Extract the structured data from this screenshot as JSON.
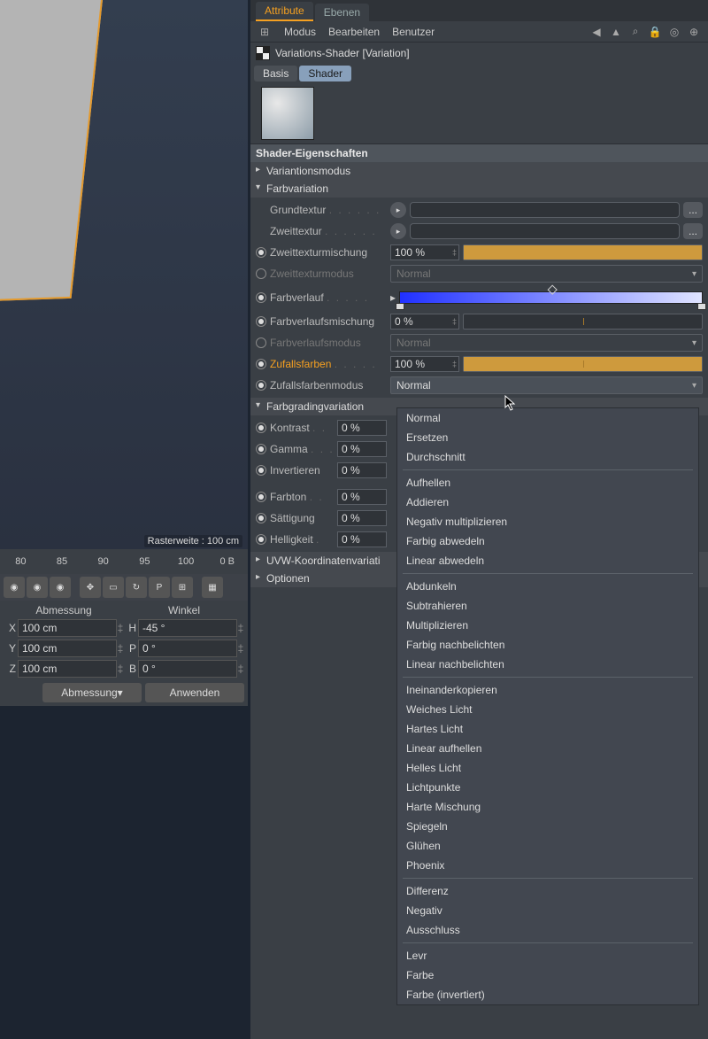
{
  "viewport": {
    "grid_label": "Rasterweite : 100 cm"
  },
  "timeline": {
    "marks": [
      "80",
      "85",
      "90",
      "95",
      "100"
    ],
    "frames": "0 B"
  },
  "coords": {
    "head_dim": "Abmessung",
    "head_ang": "Winkel",
    "x": "X",
    "y": "Y",
    "z": "Z",
    "h": "H",
    "p": "P",
    "b": "B",
    "vx": "100 cm",
    "vy": "100 cm",
    "vz": "100 cm",
    "vh": "-45 °",
    "vp": "0 °",
    "vb": "0 °",
    "mode": "Abmessung",
    "apply": "Anwenden"
  },
  "tabs": {
    "attribute": "Attribute",
    "ebenen": "Ebenen"
  },
  "menu": {
    "modus": "Modus",
    "bearbeiten": "Bearbeiten",
    "benutzer": "Benutzer"
  },
  "object_title": "Variations-Shader [Variation]",
  "subtabs": {
    "basis": "Basis",
    "shader": "Shader"
  },
  "sections": {
    "shader_props": "Shader-Eigenschaften",
    "variationsmodus": "Variantionsmodus",
    "farbvariation": "Farbvariation",
    "farbgrading": "Farbgradingvariation",
    "uvw": "UVW-Koordinatenvariati",
    "optionen": "Optionen"
  },
  "props": {
    "grundtextur": "Grundtextur",
    "zweittextur": "Zweittextur",
    "zweittexturmischung": "Zweittexturmischung",
    "zweittexturmodus": "Zweittexturmodus",
    "farbverlauf": "Farbverlauf",
    "farbverlaufsmischung": "Farbverlaufsmischung",
    "farbverlaufsmodus": "Farbverlaufsmodus",
    "zufallsfarben": "Zufallsfarben",
    "zufallsfarbenmodus": "Zufallsfarbenmodus",
    "kontrast": "Kontrast",
    "gamma": "Gamma",
    "invertieren": "Invertieren",
    "farbton": "Farbton",
    "saettigung": "Sättigung",
    "helligkeit": "Helligkeit"
  },
  "values": {
    "zweittexturmischung": "100 %",
    "zweittexturmodus": "Normal",
    "farbverlaufsmischung": "0 %",
    "farbverlaufsmodus": "Normal",
    "zufallsfarben": "100 %",
    "zufallsfarbenmodus": "Normal",
    "kontrast": "0 %",
    "gamma": "0 %",
    "invertieren": "0 %",
    "farbton": "0 %",
    "saettigung": "0 %",
    "helligkeit": "0 %"
  },
  "blend_menu": [
    "Normal",
    "Ersetzen",
    "Durchschnitt",
    "",
    "Aufhellen",
    "Addieren",
    "Negativ multiplizieren",
    "Farbig abwedeln",
    "Linear abwedeln",
    "",
    "Abdunkeln",
    "Subtrahieren",
    "Multiplizieren",
    "Farbig nachbelichten",
    "Linear nachbelichten",
    "",
    "Ineinanderkopieren",
    "Weiches Licht",
    "Hartes Licht",
    "Linear aufhellen",
    "Helles Licht",
    "Lichtpunkte",
    "Harte Mischung",
    "Spiegeln",
    "Glühen",
    "Phoenix",
    "",
    "Differenz",
    "Negativ",
    "Ausschluss",
    "",
    "Levr",
    "Farbe",
    "Farbe (invertiert)"
  ],
  "ellipsis": "..."
}
